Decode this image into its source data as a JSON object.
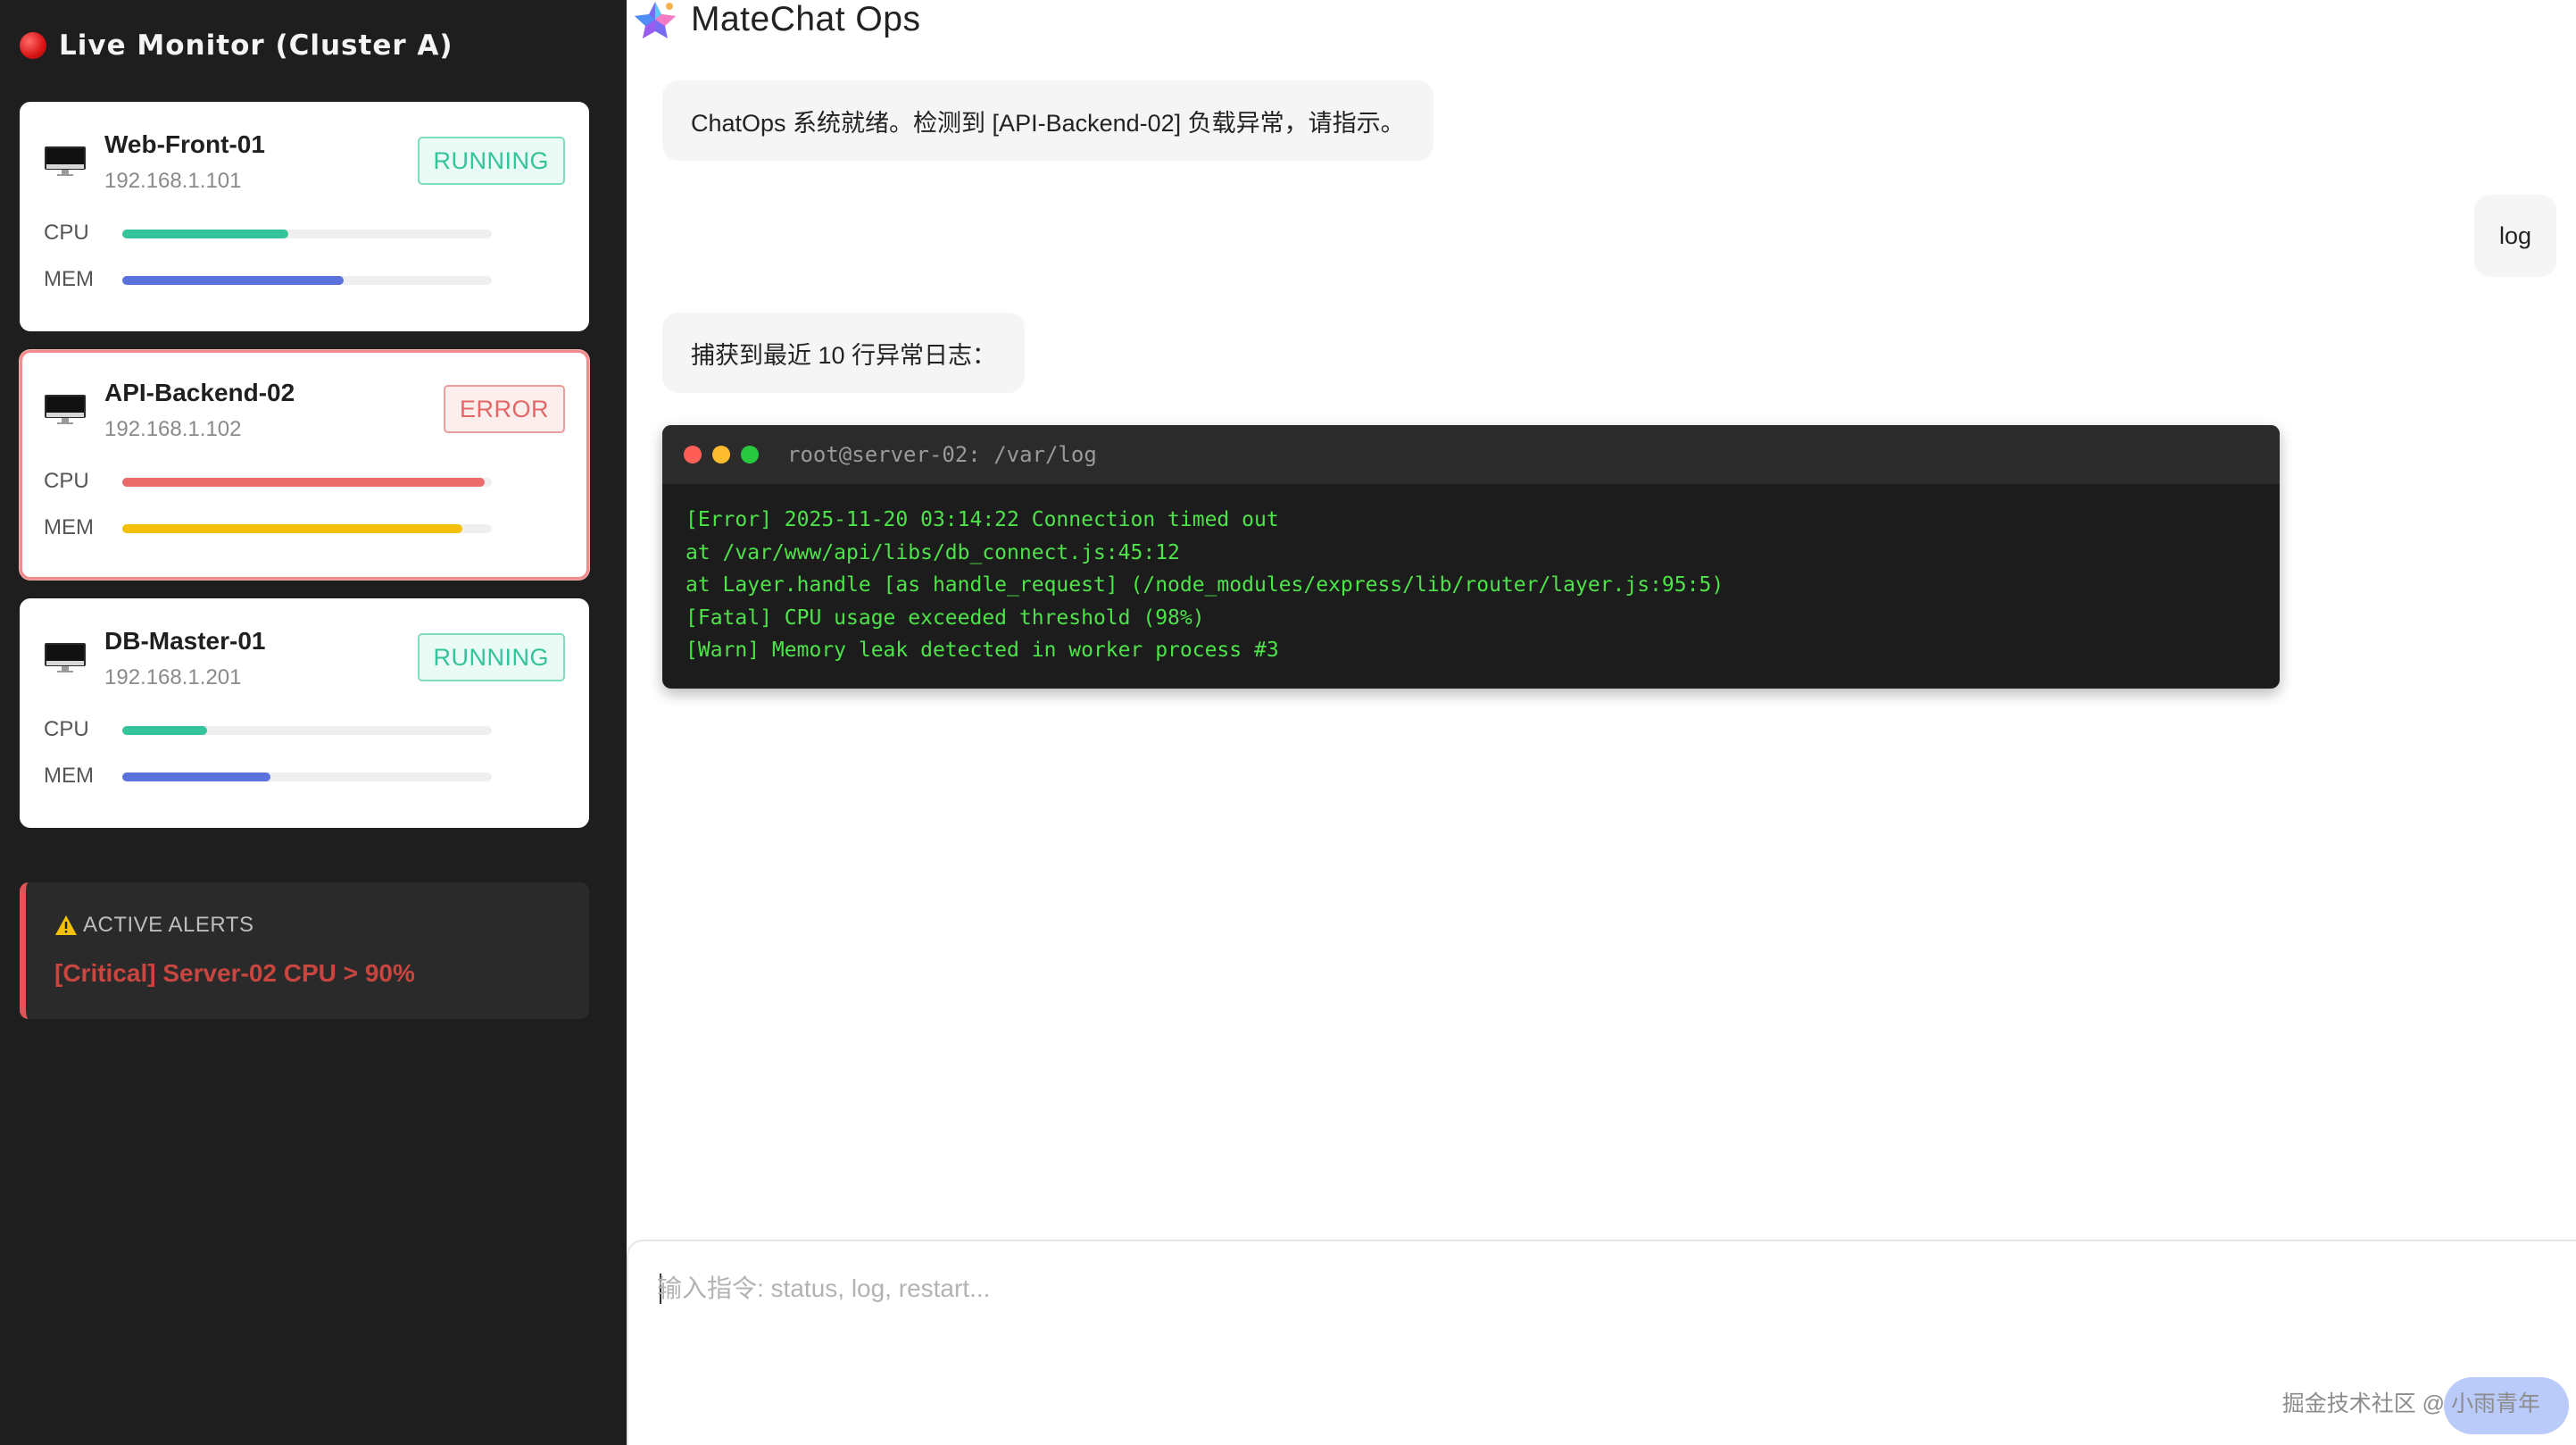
{
  "sidebar": {
    "title": "Live Monitor (Cluster A)",
    "servers": [
      {
        "name": "Web-Front-01",
        "ip": "192.168.1.101",
        "status": "RUNNING",
        "cpu_label": "CPU",
        "mem_label": "MEM",
        "cpu_pct": 45,
        "mem_pct": 60,
        "cpu_color": "#34c39a",
        "mem_color": "#5b72dc"
      },
      {
        "name": "API-Backend-02",
        "ip": "192.168.1.102",
        "status": "ERROR",
        "cpu_label": "CPU",
        "mem_label": "MEM",
        "cpu_pct": 98,
        "mem_pct": 92,
        "cpu_color": "#ea6b6b",
        "mem_color": "#f3c10b"
      },
      {
        "name": "DB-Master-01",
        "ip": "192.168.1.201",
        "status": "RUNNING",
        "cpu_label": "CPU",
        "mem_label": "MEM",
        "cpu_pct": 23,
        "mem_pct": 40,
        "cpu_color": "#34c39a",
        "mem_color": "#5b72dc"
      }
    ],
    "alerts": {
      "title": "ACTIVE ALERTS",
      "message": "[Critical] Server-02 CPU > 90%"
    }
  },
  "chat": {
    "app_title": "MateChat Ops",
    "messages": [
      {
        "role": "assistant",
        "text": "ChatOps 系统就绪。检测到 [API-Backend-02] 负载异常，请指示。"
      },
      {
        "role": "user",
        "text": "log"
      },
      {
        "role": "assistant",
        "text": "捕获到最近 10 行异常日志："
      }
    ],
    "terminal": {
      "title": "root@server-02: /var/log",
      "lines": [
        "[Error] 2025-11-20 03:14:22 Connection timed out",
        "at /var/www/api/libs/db_connect.js:45:12",
        "at Layer.handle [as handle_request] (/node_modules/express/lib/router/layer.js:95:5)",
        "[Fatal] CPU usage exceeded threshold (98%)",
        "[Warn] Memory leak detected in worker process #3"
      ]
    },
    "input": {
      "placeholder": "输入指令: status, log, restart...",
      "value": ""
    },
    "watermark": "掘金技术社区 @ 小雨青年"
  },
  "colors": {
    "running": "#34c39a",
    "error": "#e26868",
    "terminal_text": "#4ee34a",
    "alert": "#c8463f"
  }
}
